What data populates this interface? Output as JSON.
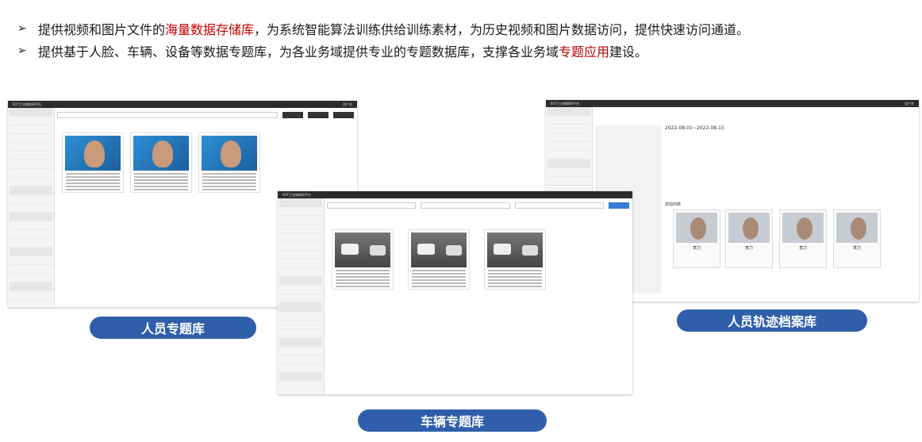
{
  "bullets": [
    {
      "parts": [
        {
          "text": "提供视频和图片文件的",
          "red": false
        },
        {
          "text": "海量数据存储库",
          "red": true
        },
        {
          "text": "，为系统智能算法训练供给训练素材，为历史视频和图片数据访问，提供快速访问通道。",
          "red": false
        }
      ]
    },
    {
      "parts": [
        {
          "text": "提供基于人脸、车辆、设备等数据专题库，为各业务域提供专业的专题数据库，支撑各业务域",
          "red": false
        },
        {
          "text": "专题应用",
          "red": true
        },
        {
          "text": "建设。",
          "red": false
        }
      ]
    }
  ],
  "arrow_glyph": "➢",
  "screens": {
    "person": {
      "app_title": "IIOT工业物联网平台",
      "user": "用户名",
      "label": "人员专题库"
    },
    "vehicle": {
      "app_title": "IIOT工业物联网平台",
      "label": "车辆专题库"
    },
    "track": {
      "app_title": "IIOT工业物联网平台",
      "user": "用户名",
      "date_range": "2022-08-01~2022-08-15",
      "section": "抓拍列表",
      "name": "李力",
      "label": "人员轨迹档案库"
    }
  }
}
